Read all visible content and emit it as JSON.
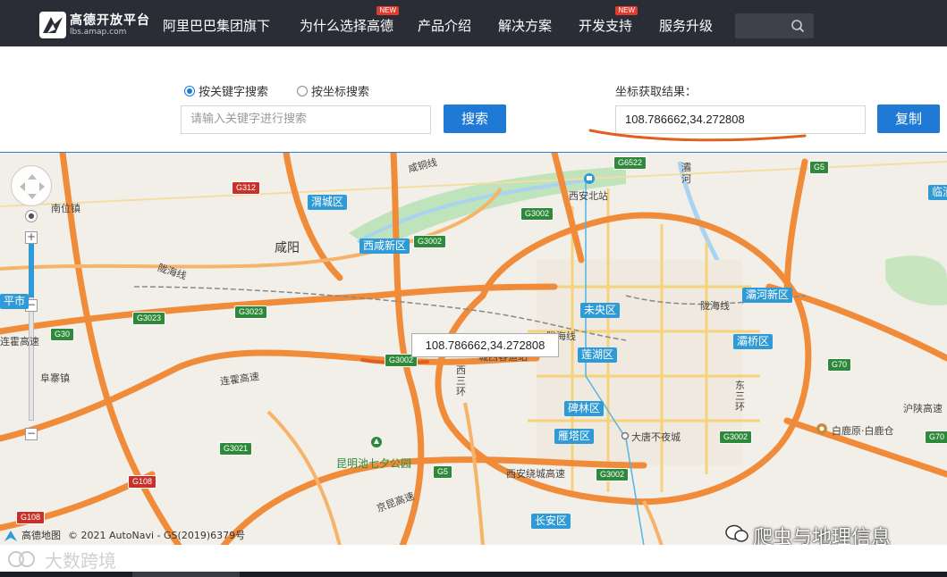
{
  "header": {
    "logo_title": "高德开放平台",
    "logo_sub": "lbs.amap.com",
    "nav": [
      {
        "label": "阿里巴巴集团旗下",
        "new": false
      },
      {
        "label": "为什么选择高德",
        "new": true
      },
      {
        "label": "产品介绍",
        "new": false
      },
      {
        "label": "解决方案",
        "new": false
      },
      {
        "label": "开发支持",
        "new": true
      },
      {
        "label": "服务升级",
        "new": false
      }
    ],
    "new_badge": "NEW",
    "search_icon": "search-icon"
  },
  "tool": {
    "radio_keyword": "按关键字搜索",
    "radio_coord": "按坐标搜索",
    "selected": "keyword",
    "keyword_placeholder": "请输入关键字进行搜索",
    "search_button": "搜索",
    "result_label": "坐标获取结果：",
    "result_value": "108.786662,34.272808",
    "copy_button": "复制"
  },
  "map": {
    "tooltip": "108.786662,34.272808",
    "districts": [
      "渭城区",
      "西咸新区",
      "未央区",
      "灞桥区",
      "莲湖区",
      "碑林区",
      "雁塔区",
      "长安区",
      "灞河新区",
      "临潼",
      "平市"
    ],
    "road_signs": [
      "G6522",
      "G5",
      "G312",
      "G3002",
      "G3002",
      "G3023",
      "G3023",
      "G30",
      "G3002",
      "G3002",
      "G3021",
      "G5",
      "G3002",
      "G108",
      "G108",
      "G70",
      "G70"
    ],
    "places": [
      "咸阳",
      "南位镇",
      "陇海线",
      "陇海线",
      "陇海线",
      "连霍高速",
      "连霍高速",
      "阜寨镇",
      "西安北站",
      "城西客运站",
      "西三环",
      "东三环",
      "大唐不夜城",
      "昆明池七夕公园",
      "西安绕城高速",
      "京昆高速",
      "白鹿原·白鹿仓",
      "沪陕高速",
      "灞河",
      "咸铜线"
    ],
    "footer_logo": "高德地图",
    "copyright": "© 2021 AutoNavi - GS(2019)6379号",
    "watermark_left": "大数跨境",
    "watermark_right": "爬虫与地理信息"
  },
  "colors": {
    "header_bg": "#2a2d36",
    "accent_blue": "#1f7ad6",
    "district_blue": "#2f9ad6",
    "road_orange": "#f08b3a",
    "annotation_orange": "#e0601e"
  }
}
